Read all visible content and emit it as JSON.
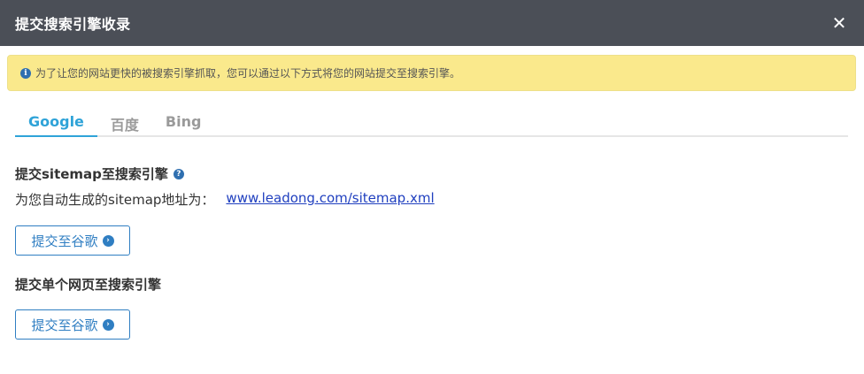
{
  "dialog": {
    "title": "提交搜索引擎收录",
    "close_symbol": "✕"
  },
  "notice": {
    "icon": "info-icon",
    "text": "为了让您的网站更快的被搜索引擎抓取，您可以通过以下方式将您的网站提交至搜索引擎。"
  },
  "tabs": [
    {
      "label": "Google",
      "active": true
    },
    {
      "label": "百度",
      "active": false
    },
    {
      "label": "Bing",
      "active": false
    }
  ],
  "section1": {
    "title": "提交sitemap至搜索引擎",
    "help_icon": "question-icon",
    "desc_prefix": "为您自动生成的sitemap地址为：",
    "sitemap_url": "www.leadong.com/sitemap.xml",
    "button_label": "提交至谷歌"
  },
  "section2": {
    "title": "提交单个网页至搜索引擎",
    "button_label": "提交至谷歌"
  },
  "colors": {
    "header_bg": "#4b4f57",
    "notice_bg": "#fae98c",
    "accent": "#2fa3d8",
    "button": "#2f7ec2",
    "link": "#1f3fbf"
  }
}
